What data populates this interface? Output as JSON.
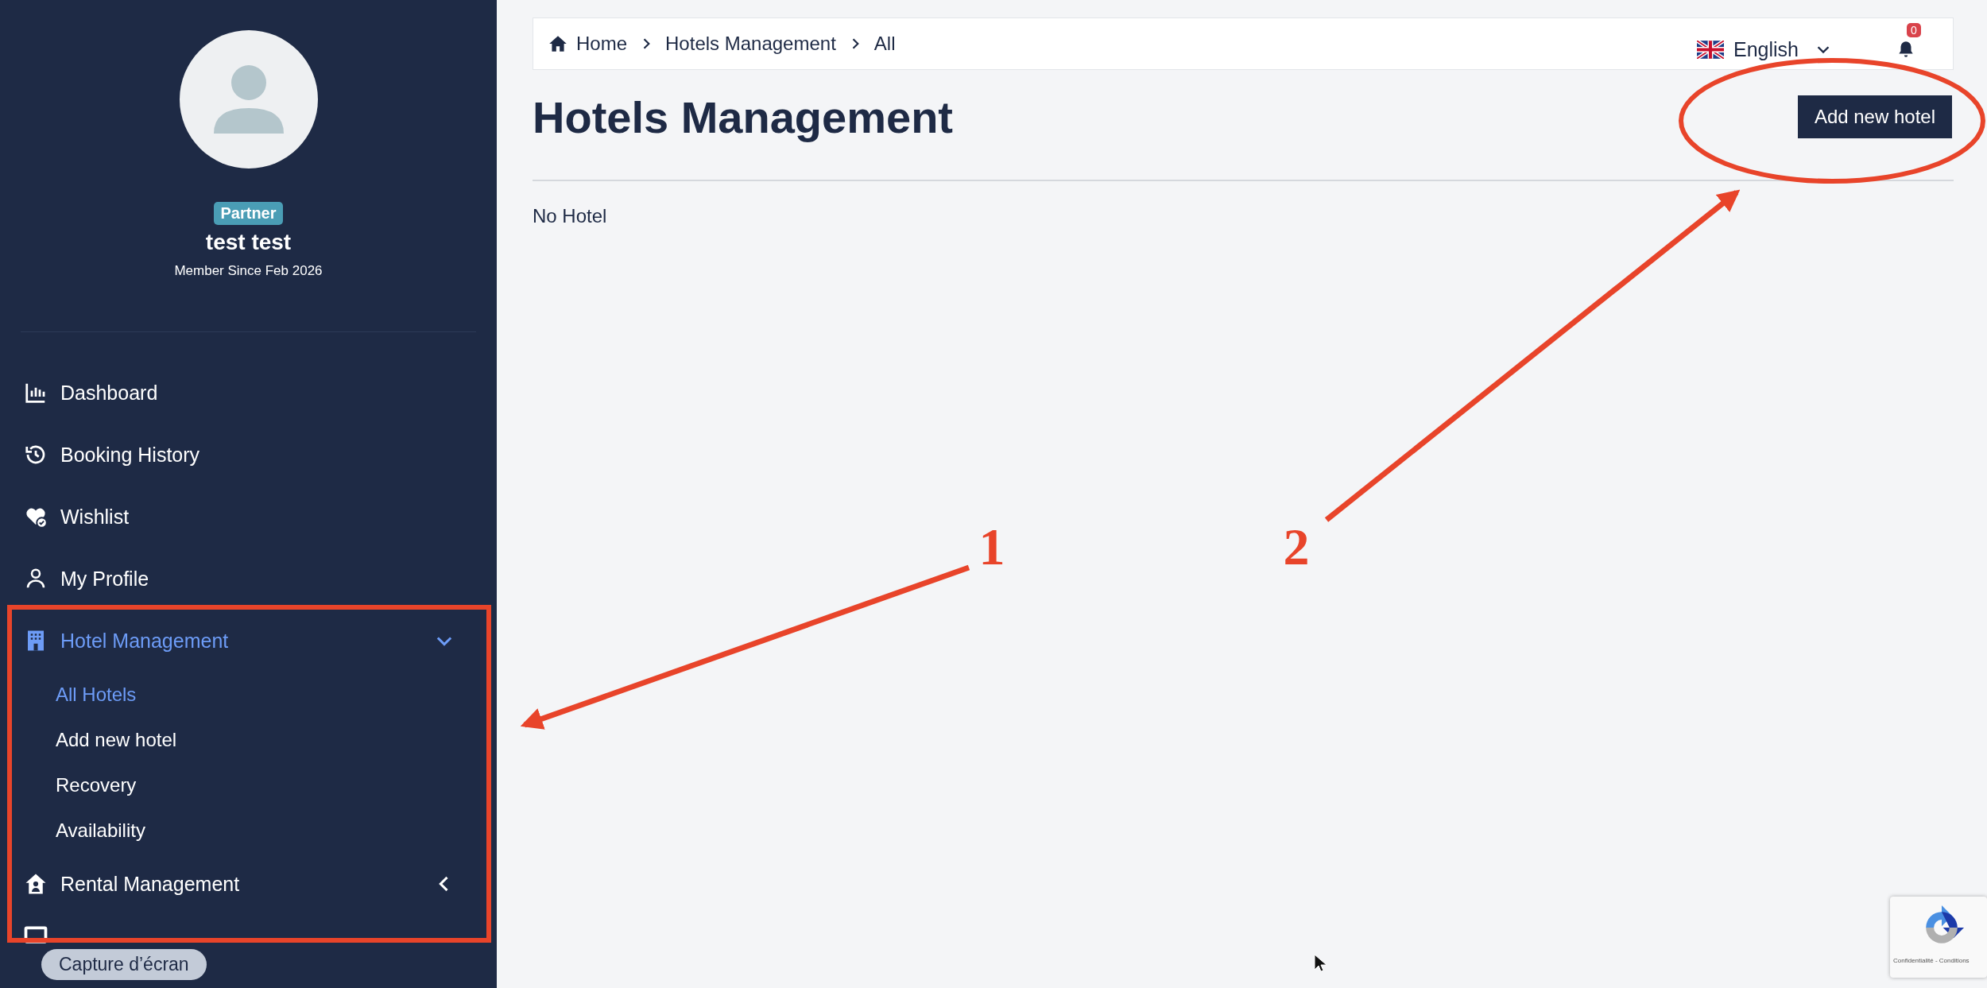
{
  "sidebar": {
    "role_badge": "Partner",
    "user_name": "test test",
    "member_since": "Member Since Feb 2026",
    "items": [
      {
        "label": "Dashboard",
        "kind": "link",
        "selected": false
      },
      {
        "label": "Booking History",
        "kind": "link",
        "selected": false
      },
      {
        "label": "Wishlist",
        "kind": "link",
        "selected": false
      },
      {
        "label": "My Profile",
        "kind": "link",
        "selected": false
      },
      {
        "label": "Hotel Management",
        "kind": "group",
        "selected": true,
        "expanded": true,
        "children": [
          {
            "label": "All Hotels",
            "selected": true
          },
          {
            "label": "Add new hotel",
            "selected": false
          },
          {
            "label": "Recovery",
            "selected": false
          },
          {
            "label": "Availability",
            "selected": false
          }
        ]
      },
      {
        "label": "Rental Management",
        "kind": "group",
        "selected": false,
        "expanded": false
      }
    ]
  },
  "breadcrumb": [
    "Home",
    "Hotels Management",
    "All"
  ],
  "language": "English",
  "notifications": "0",
  "page_title": "Hotels Management",
  "add_button": "Add new hotel",
  "empty_message": "No Hotel",
  "tooltip": "Capture d’écran",
  "recaptcha": {
    "links": "Confidentialité - Conditions"
  },
  "annotations": [
    "1",
    "2"
  ]
}
